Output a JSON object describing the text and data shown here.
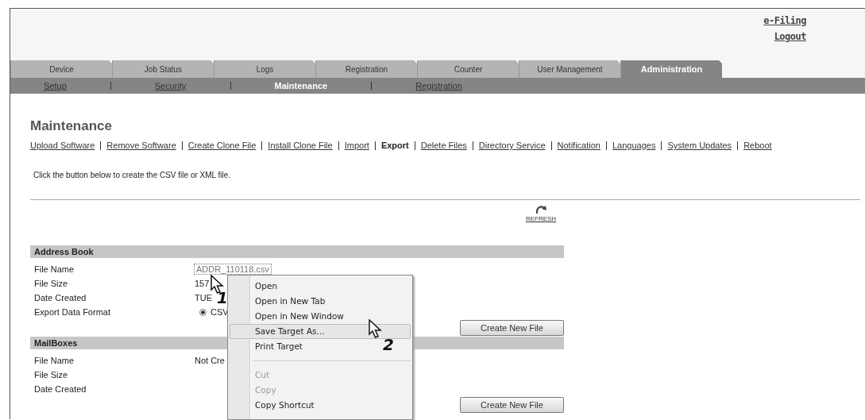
{
  "header_links": [
    "e-Filing",
    "Logout"
  ],
  "tabs": [
    {
      "label": "Device",
      "selected": false
    },
    {
      "label": "Job Status",
      "selected": false
    },
    {
      "label": "Logs",
      "selected": false
    },
    {
      "label": "Registration",
      "selected": false
    },
    {
      "label": "Counter",
      "selected": false
    },
    {
      "label": "User Management",
      "selected": false
    },
    {
      "label": "Administration",
      "selected": true
    }
  ],
  "subtabs": [
    {
      "label": "Setup",
      "selected": false
    },
    {
      "label": "Security",
      "selected": false
    },
    {
      "label": "Maintenance",
      "selected": true
    },
    {
      "label": "Registration",
      "selected": false
    }
  ],
  "page_title": "Maintenance",
  "page_links": [
    {
      "label": "Upload Software",
      "selected": false
    },
    {
      "label": "Remove Software",
      "selected": false
    },
    {
      "label": "Create Clone File",
      "selected": false
    },
    {
      "label": "Install Clone File",
      "selected": false
    },
    {
      "label": "Import",
      "selected": false
    },
    {
      "label": "Export",
      "selected": true
    },
    {
      "label": "Delete Files",
      "selected": false
    },
    {
      "label": "Directory Service",
      "selected": false
    },
    {
      "label": "Notification",
      "selected": false
    },
    {
      "label": "Languages",
      "selected": false
    },
    {
      "label": "System Updates",
      "selected": false
    },
    {
      "label": "Reboot",
      "selected": false
    }
  ],
  "description": "Click the button below to create the CSV file or XML file.",
  "refresh_label": "REFRESH",
  "sections": [
    {
      "title": "Address Book",
      "rows": [
        {
          "kind": "link",
          "label": "File Name",
          "value": "ADDR_110118.csv"
        },
        {
          "kind": "text",
          "label": "File Size",
          "value": "157"
        },
        {
          "kind": "text",
          "label": "Date Created",
          "value": "TUE"
        },
        {
          "kind": "radio",
          "label": "Export Data Format",
          "value": "CSV",
          "checked": true
        }
      ],
      "button": "Create New File"
    },
    {
      "title": "MailBoxes",
      "rows": [
        {
          "kind": "text",
          "label": "File Name",
          "value": "Not Cre"
        },
        {
          "kind": "text",
          "label": "File Size"
        },
        {
          "kind": "text",
          "label": "Date Created"
        }
      ],
      "button": "Create New File"
    }
  ],
  "context_menu": [
    {
      "kind": "item",
      "label": "Open",
      "disabled": false,
      "selected": false
    },
    {
      "kind": "item",
      "label": "Open in New Tab",
      "disabled": false,
      "selected": false
    },
    {
      "kind": "item",
      "label": "Open in New Window",
      "disabled": false,
      "selected": false
    },
    {
      "kind": "item",
      "label": "Save Target As...",
      "disabled": false,
      "selected": true
    },
    {
      "kind": "item",
      "label": "Print Target",
      "disabled": false,
      "selected": false
    },
    {
      "kind": "separator"
    },
    {
      "kind": "item",
      "label": "Cut",
      "disabled": true,
      "selected": false
    },
    {
      "kind": "item",
      "label": "Copy",
      "disabled": true,
      "selected": false
    },
    {
      "kind": "item",
      "label": "Copy Shortcut",
      "disabled": false,
      "selected": false
    }
  ],
  "callouts": [
    "1",
    "2"
  ]
}
